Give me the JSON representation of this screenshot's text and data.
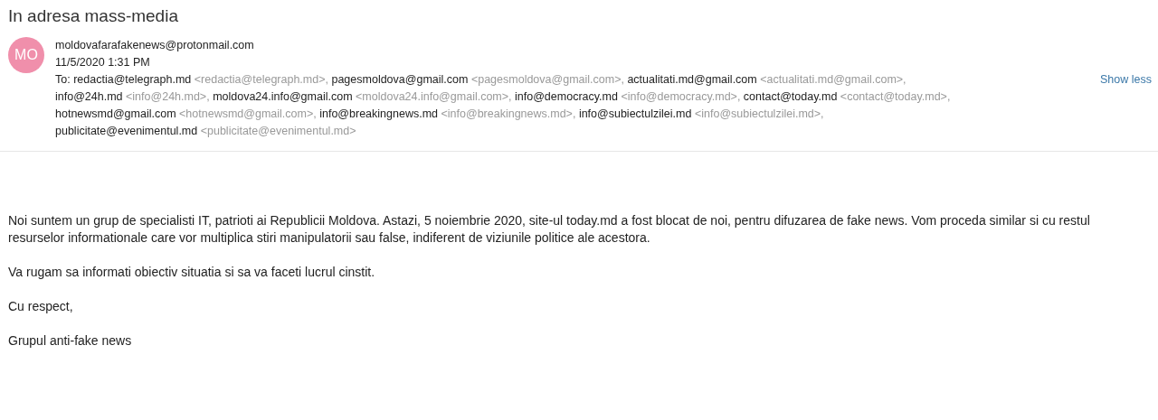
{
  "subject": "In adresa mass-media",
  "sender": {
    "avatar": "MO",
    "email": "moldovafarafakenews@protonmail.com",
    "date": "11/5/2020 1:31 PM"
  },
  "to_label": "To:",
  "to_lines": [
    [
      {
        "name": "redactia@telegraph.md",
        "address": "<redactia@telegraph.md>,"
      },
      {
        "name": "pagesmoldova@gmail.com",
        "address": "<pagesmoldova@gmail.com>,"
      },
      {
        "name": "actualitati.md@gmail.com",
        "address": "<actualitati.md@gmail.com>,"
      }
    ],
    [
      {
        "name": "info@24h.md",
        "address": "<info@24h.md>,"
      },
      {
        "name": "moldova24.info@gmail.com",
        "address": "<moldova24.info@gmail.com>,"
      },
      {
        "name": "info@democracy.md",
        "address": "<info@democracy.md>,"
      },
      {
        "name": "contact@today.md",
        "address": "<contact@today.md>,"
      }
    ],
    [
      {
        "name": "hotnewsmd@gmail.com",
        "address": "<hotnewsmd@gmail.com>,"
      },
      {
        "name": "info@breakingnews.md",
        "address": "<info@breakingnews.md>,"
      },
      {
        "name": "info@subiectulzilei.md",
        "address": "<info@subiectulzilei.md>,"
      }
    ],
    [
      {
        "name": "publicitate@evenimentul.md",
        "address": "<publicitate@evenimentul.md>"
      }
    ]
  ],
  "show_less": "Show less",
  "body": [
    "Noi suntem un grup de specialisti IT, patrioti ai Republicii Moldova. Astazi, 5 noiembrie 2020, site-ul today.md a fost blocat de noi, pentru difuzarea de fake news. Vom proceda similar si cu restul resurselor informationale care vor multiplica stiri manipulatorii sau false, indiferent de viziunile politice ale acestora.",
    "Va rugam sa informati obiectiv situatia si sa va faceti lucrul cinstit.",
    "Cu respect,",
    "Grupul anti-fake news"
  ]
}
